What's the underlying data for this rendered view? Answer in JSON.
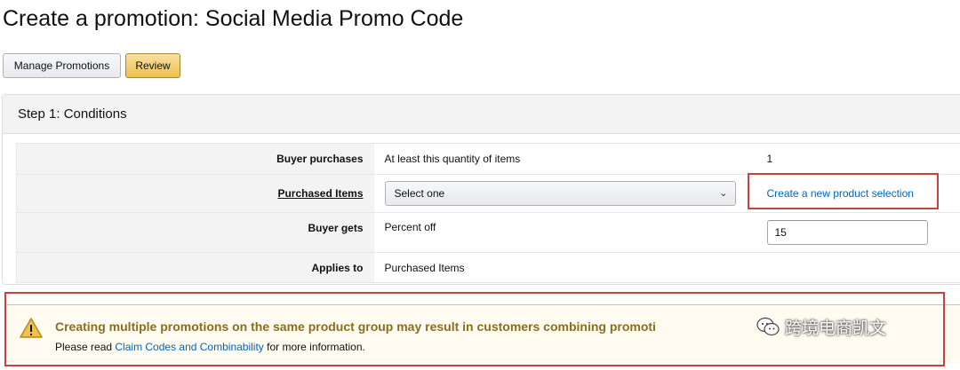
{
  "page": {
    "title": "Create a promotion: Social Media Promo Code"
  },
  "actions": {
    "manage_label": "Manage Promotions",
    "review_label": "Review"
  },
  "step": {
    "title": "Step 1: Conditions"
  },
  "conditions": {
    "buyer_purchases": {
      "label": "Buyer purchases",
      "type": "At least this quantity of items",
      "value": "1"
    },
    "purchased_items": {
      "label": "Purchased Items",
      "select_value": "Select one",
      "link": "Create a new product selection"
    },
    "buyer_gets": {
      "label": "Buyer gets",
      "type": "Percent off",
      "value": "15"
    },
    "applies_to": {
      "label": "Applies to",
      "value": "Purchased Items"
    }
  },
  "alert": {
    "title": "Creating multiple promotions on the same product group may result in customers combining promoti",
    "text_before": "Please read ",
    "link": "Claim Codes and Combinability",
    "text_after": " for more information.",
    "icon": "warning-icon"
  },
  "watermark": {
    "text": "跨境电商凯文",
    "icon": "wechat-icon"
  },
  "colors": {
    "highlight": "#c8413b",
    "link": "#0066c0",
    "alert_title": "#8a6d1e",
    "review_button": "#f0c14b"
  }
}
